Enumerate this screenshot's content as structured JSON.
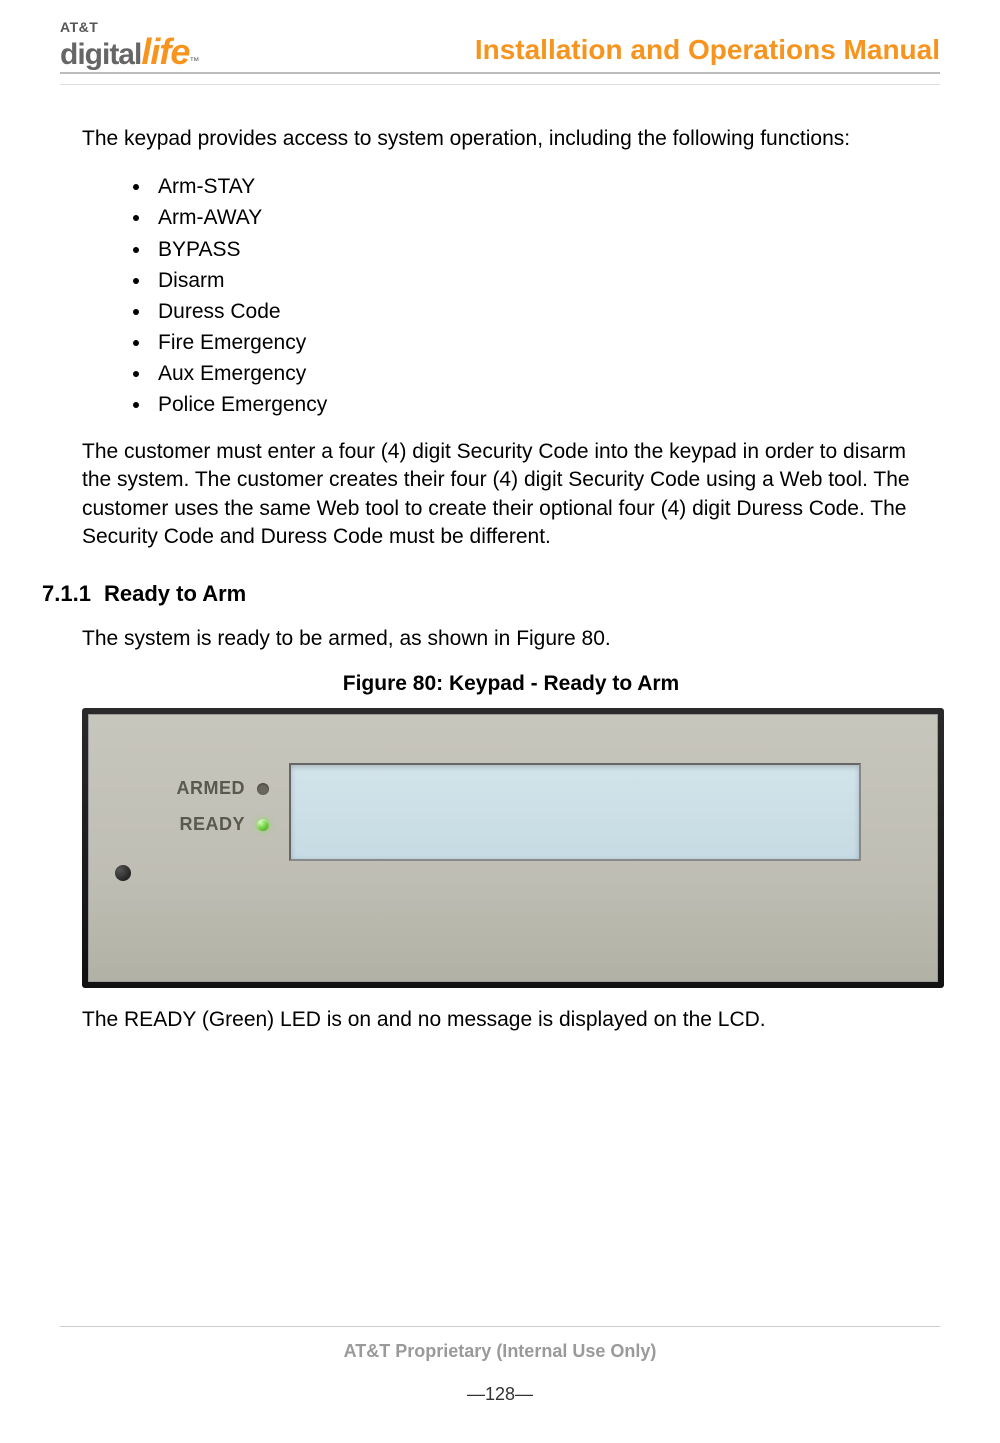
{
  "header": {
    "logo_top": "AT&T",
    "logo_word1": "digital",
    "logo_word2": "life",
    "logo_tm": "™",
    "doc_title": "Installation and Operations Manual"
  },
  "intro_para": "The keypad provides access to system operation, including the following functions:",
  "function_list": [
    "Arm-STAY",
    "Arm-AWAY",
    "BYPASS",
    "Disarm",
    "Duress Code",
    "Fire Emergency",
    "Aux Emergency",
    "Police Emergency"
  ],
  "security_para": "The customer must enter a four (4) digit Security Code into the keypad in order to disarm the system. The customer creates their four (4) digit Security Code using a Web tool. The customer uses the same Web tool to create their optional four (4) digit Duress Code. The Security Code and Duress Code must be different.",
  "section": {
    "number": "7.1.1",
    "title": "Ready to Arm"
  },
  "ready_para": "The system is ready to be armed, as shown in Figure 80.",
  "figure_caption": "Figure 80:  Keypad - Ready to Arm",
  "keypad": {
    "armed_label": "ARMED",
    "ready_label": "READY"
  },
  "post_fig_para": "The READY (Green) LED is on and no message is displayed on the LCD.",
  "footer": {
    "proprietary": "AT&T Proprietary (Internal Use Only)",
    "page_number": "―128―"
  }
}
